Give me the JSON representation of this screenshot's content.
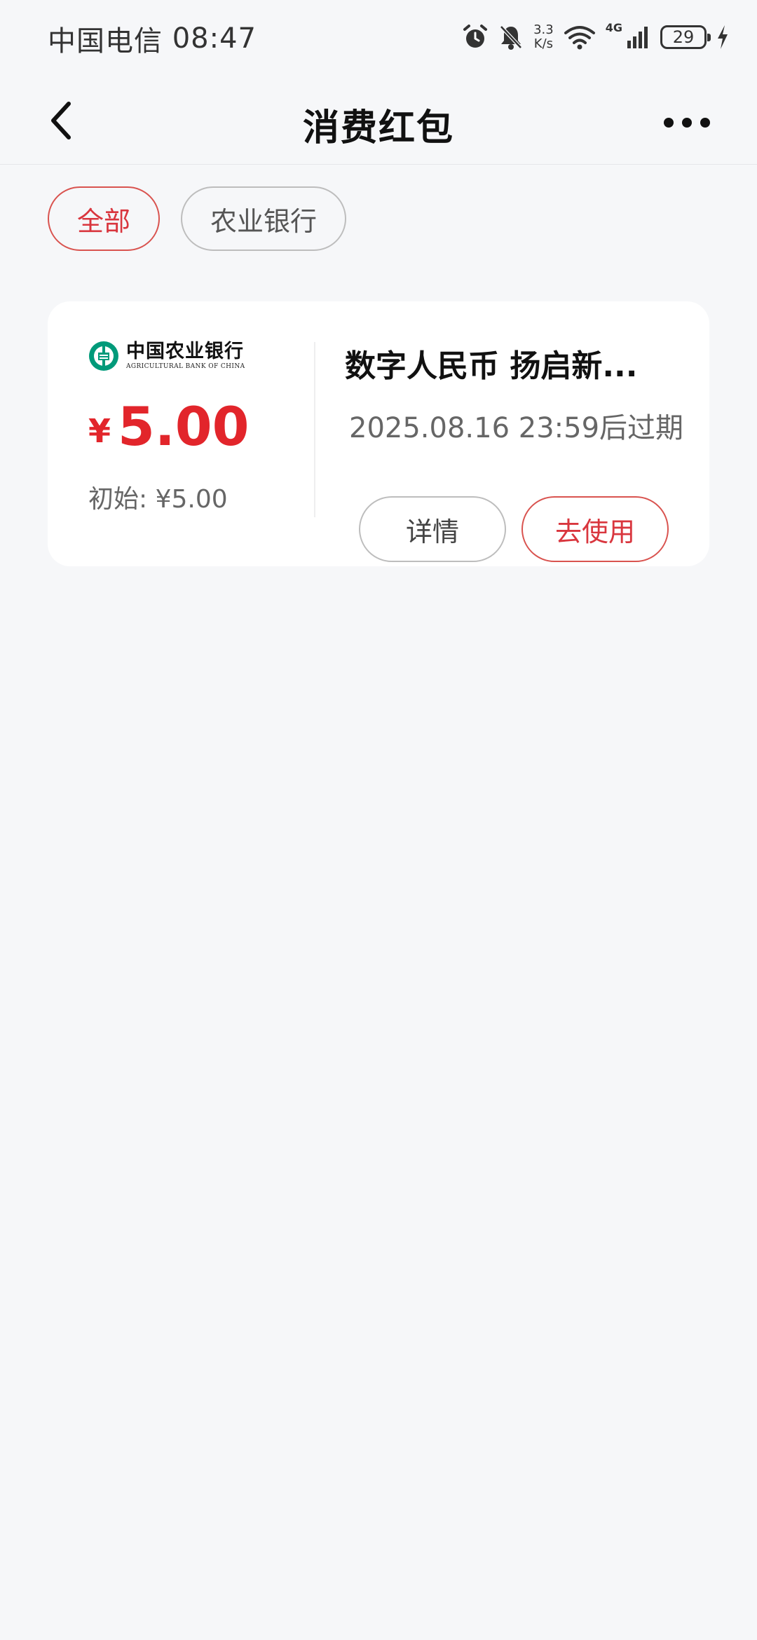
{
  "status_bar": {
    "carrier": "中国电信",
    "time": "08:47",
    "net_speed_value": "3.3",
    "net_speed_unit": "K/s",
    "network_type": "4G",
    "battery_level": "29",
    "icons": [
      "alarm-icon",
      "mute-bell-icon",
      "wifi-icon",
      "signal-icon",
      "battery-icon",
      "charging-icon"
    ]
  },
  "nav": {
    "title": "消费红包",
    "back_icon": "chevron-left-icon",
    "more_icon": "more-dots-icon"
  },
  "filters": [
    {
      "label": "全部",
      "selected": true
    },
    {
      "label": "农业银行",
      "selected": false
    }
  ],
  "coupon": {
    "bank_name_cn": "中国农业银行",
    "bank_name_en": "AGRICULTURAL BANK OF CHINA",
    "currency_symbol": "¥",
    "amount": "5.00",
    "initial_label": "初始: ¥5.00",
    "title": "数字人民币 扬启新...",
    "expiry": "2025.08.16 23:59后过期",
    "detail_button": "详情",
    "use_button": "去使用"
  },
  "colors": {
    "accent_red": "#e2252b",
    "abc_green": "#009a7a",
    "background": "#f6f7f9"
  }
}
